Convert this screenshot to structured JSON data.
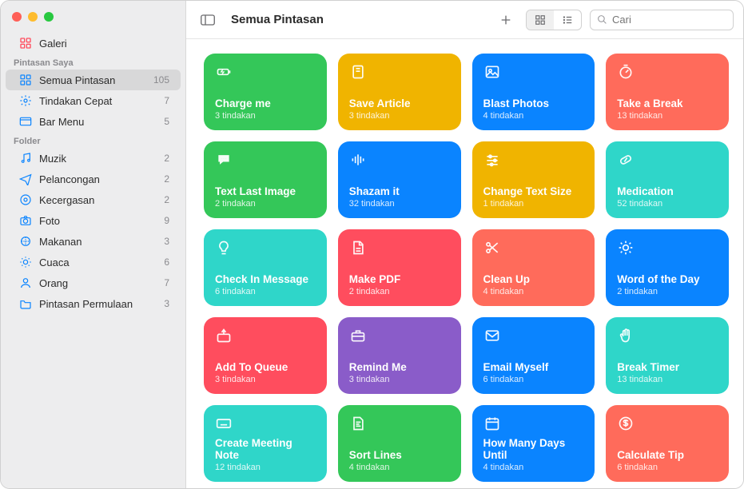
{
  "header": {
    "title": "Semua Pintasan",
    "search_placeholder": "Cari"
  },
  "sidebar": {
    "gallery_label": "Galeri",
    "section_my": "Pintasan Saya",
    "my_items": [
      {
        "icon": "grid",
        "label": "Semua Pintasan",
        "count": "105",
        "selected": true
      },
      {
        "icon": "gear",
        "label": "Tindakan Cepat",
        "count": "7",
        "selected": false
      },
      {
        "icon": "menubar",
        "label": "Bar Menu",
        "count": "5",
        "selected": false
      }
    ],
    "section_folder": "Folder",
    "folder_items": [
      {
        "icon": "music",
        "label": "Muzik",
        "count": "2"
      },
      {
        "icon": "plane",
        "label": "Pelancongan",
        "count": "2"
      },
      {
        "icon": "fitness",
        "label": "Kecergasan",
        "count": "2"
      },
      {
        "icon": "camera",
        "label": "Foto",
        "count": "9"
      },
      {
        "icon": "food",
        "label": "Makanan",
        "count": "3"
      },
      {
        "icon": "sun",
        "label": "Cuaca",
        "count": "6"
      },
      {
        "icon": "person",
        "label": "Orang",
        "count": "7"
      },
      {
        "icon": "folder",
        "label": "Pintasan Permulaan",
        "count": "3"
      }
    ]
  },
  "action_unit": "tindakan",
  "shortcuts": [
    {
      "title": "Charge me",
      "actions": 3,
      "color": "#34c759",
      "icon": "battery"
    },
    {
      "title": "Save Article",
      "actions": 3,
      "color": "#f0b400",
      "icon": "book"
    },
    {
      "title": "Blast Photos",
      "actions": 4,
      "color": "#0a84ff",
      "icon": "image"
    },
    {
      "title": "Take a Break",
      "actions": 13,
      "color": "#ff6b5b",
      "icon": "timer"
    },
    {
      "title": "Text Last Image",
      "actions": 2,
      "color": "#34c759",
      "icon": "bubble"
    },
    {
      "title": "Shazam it",
      "actions": 32,
      "color": "#0a84ff",
      "icon": "wave"
    },
    {
      "title": "Change Text Size",
      "actions": 1,
      "color": "#f0b400",
      "icon": "sliders"
    },
    {
      "title": "Medication",
      "actions": 52,
      "color": "#2fd6c9",
      "icon": "pill"
    },
    {
      "title": "Check In Message",
      "actions": 6,
      "color": "#2fd6c9",
      "icon": "bulb"
    },
    {
      "title": "Make PDF",
      "actions": 2,
      "color": "#ff4d5e",
      "icon": "doc"
    },
    {
      "title": "Clean Up",
      "actions": 4,
      "color": "#ff6b5b",
      "icon": "scissors"
    },
    {
      "title": "Word of the Day",
      "actions": 2,
      "color": "#0a84ff",
      "icon": "brightness"
    },
    {
      "title": "Add To Queue",
      "actions": 3,
      "color": "#ff4d5e",
      "icon": "queue"
    },
    {
      "title": "Remind Me",
      "actions": 3,
      "color": "#8a5cc9",
      "icon": "briefcase"
    },
    {
      "title": "Email Myself",
      "actions": 6,
      "color": "#0a84ff",
      "icon": "mail"
    },
    {
      "title": "Break Timer",
      "actions": 13,
      "color": "#2fd6c9",
      "icon": "hand"
    },
    {
      "title": "Create Meeting Note",
      "actions": 12,
      "color": "#2fd6c9",
      "icon": "keyboard"
    },
    {
      "title": "Sort Lines",
      "actions": 4,
      "color": "#34c759",
      "icon": "lines"
    },
    {
      "title": "How Many Days Until",
      "actions": 4,
      "color": "#0a84ff",
      "icon": "calendar"
    },
    {
      "title": "Calculate Tip",
      "actions": 6,
      "color": "#ff6b5b",
      "icon": "dollar"
    }
  ]
}
